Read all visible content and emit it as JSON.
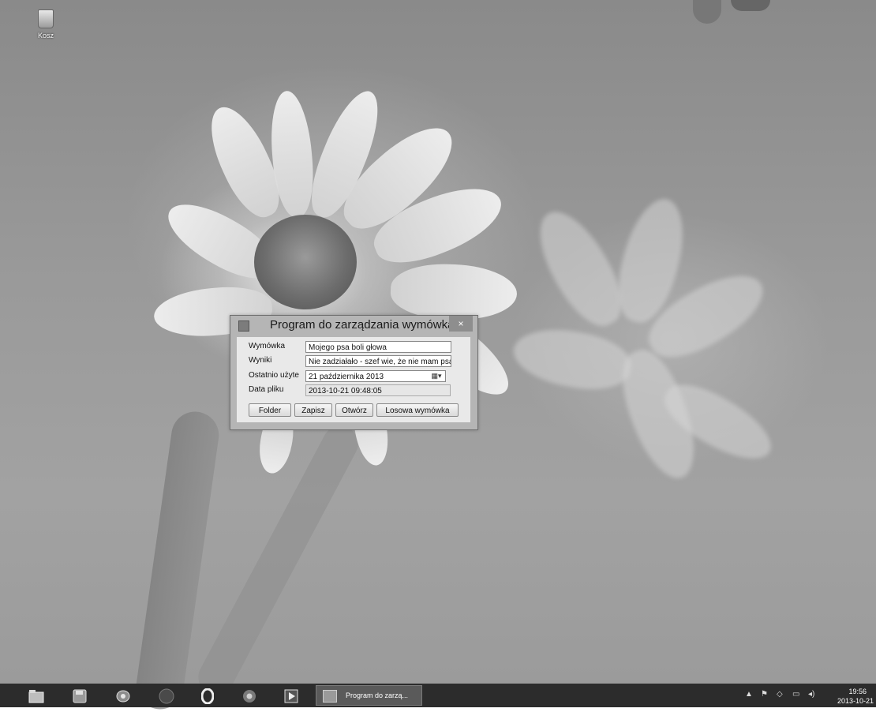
{
  "desktop": {
    "recycle_bin_label": "Kosz"
  },
  "dialog": {
    "title": "Program do zarządzania wymówkami",
    "close_glyph": "×",
    "fields": {
      "excuse_label": "Wymówka",
      "excuse_value": "Mojego psa boli głowa",
      "results_label": "Wyniki",
      "results_value": "Nie zadziałało - szef wie, że nie mam psa!",
      "last_used_label": "Ostatnio użyte",
      "last_used_value": "21 października 2013",
      "file_date_label": "Data pliku",
      "file_date_value": "2013-10-21 09:48:05"
    },
    "buttons": {
      "folder": "Folder",
      "save": "Zapisz",
      "open": "Otwórz",
      "random": "Losowa wymówka"
    }
  },
  "taskbar": {
    "icons": [
      "file-explorer-icon",
      "floppy-icon",
      "network-icon",
      "browser-icon",
      "opera-icon",
      "chrome-icon",
      "media-player-icon"
    ],
    "active_window_label": "Program do zarzą...",
    "clock_time": "19:56",
    "clock_date": "2013-10-21"
  }
}
